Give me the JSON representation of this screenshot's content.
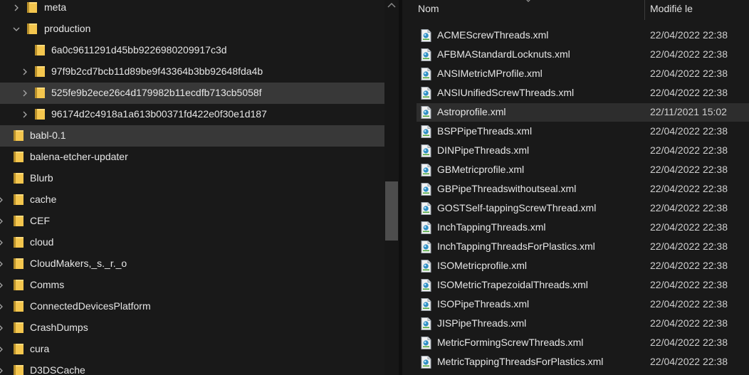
{
  "tree": {
    "items": [
      {
        "label": "meta",
        "expanded": false,
        "selected": false
      },
      {
        "label": "production",
        "expanded": true,
        "selected": false
      },
      {
        "label": "6a0c9611291d45bb9226980209917c3d",
        "expanded": null,
        "selected": false
      },
      {
        "label": "97f9b2cd7bcb11d89be9f43364b3bb92648fda4b",
        "expanded": false,
        "selected": false
      },
      {
        "label": "525fe9b2ece26c4d179982b11ecdfb713cb5058f",
        "expanded": false,
        "selected": true
      },
      {
        "label": "96174d2c4918a1a613b00371fd422e0f30e1d187",
        "expanded": false,
        "selected": false
      },
      {
        "label": "babl-0.1",
        "expanded": null,
        "selected": true
      },
      {
        "label": "balena-etcher-updater",
        "expanded": null,
        "selected": false
      },
      {
        "label": "Blurb",
        "expanded": false,
        "selected": false
      },
      {
        "label": "cache",
        "expanded": false,
        "selected": false
      },
      {
        "label": "CEF",
        "expanded": false,
        "selected": false
      },
      {
        "label": "cloud",
        "expanded": false,
        "selected": false
      },
      {
        "label": "CloudMakers,_s._r._o",
        "expanded": false,
        "selected": false
      },
      {
        "label": "Comms",
        "expanded": false,
        "selected": false
      },
      {
        "label": "ConnectedDevicesPlatform",
        "expanded": false,
        "selected": false
      },
      {
        "label": "CrashDumps",
        "expanded": false,
        "selected": false
      },
      {
        "label": "cura",
        "expanded": false,
        "selected": false
      },
      {
        "label": "D3DSCache",
        "expanded": false,
        "selected": false
      }
    ]
  },
  "list": {
    "col_name": "Nom",
    "col_modified": "Modifié le",
    "files": [
      {
        "name": "ACMEScrewThreads.xml",
        "modified": "22/04/2022 22:38",
        "selected": false
      },
      {
        "name": "AFBMAStandardLocknuts.xml",
        "modified": "22/04/2022 22:38",
        "selected": false
      },
      {
        "name": "ANSIMetricMProfile.xml",
        "modified": "22/04/2022 22:38",
        "selected": false
      },
      {
        "name": "ANSIUnifiedScrewThreads.xml",
        "modified": "22/04/2022 22:38",
        "selected": false
      },
      {
        "name": "Astroprofile.xml",
        "modified": "22/11/2021 15:02",
        "selected": true
      },
      {
        "name": "BSPPipeThreads.xml",
        "modified": "22/04/2022 22:38",
        "selected": false
      },
      {
        "name": "DINPipeThreads.xml",
        "modified": "22/04/2022 22:38",
        "selected": false
      },
      {
        "name": "GBMetricprofile.xml",
        "modified": "22/04/2022 22:38",
        "selected": false
      },
      {
        "name": "GBPipeThreadswithoutseal.xml",
        "modified": "22/04/2022 22:38",
        "selected": false
      },
      {
        "name": "GOSTSelf-tappingScrewThread.xml",
        "modified": "22/04/2022 22:38",
        "selected": false
      },
      {
        "name": "InchTappingThreads.xml",
        "modified": "22/04/2022 22:38",
        "selected": false
      },
      {
        "name": "InchTappingThreadsForPlastics.xml",
        "modified": "22/04/2022 22:38",
        "selected": false
      },
      {
        "name": "ISOMetricprofile.xml",
        "modified": "22/04/2022 22:38",
        "selected": false
      },
      {
        "name": "ISOMetricTrapezoidalThreads.xml",
        "modified": "22/04/2022 22:38",
        "selected": false
      },
      {
        "name": "ISOPipeThreads.xml",
        "modified": "22/04/2022 22:38",
        "selected": false
      },
      {
        "name": "JISPipeThreads.xml",
        "modified": "22/04/2022 22:38",
        "selected": false
      },
      {
        "name": "MetricFormingScrewThreads.xml",
        "modified": "22/04/2022 22:38",
        "selected": false
      },
      {
        "name": "MetricTappingThreadsForPlastics.xml",
        "modified": "22/04/2022 22:38",
        "selected": false
      }
    ]
  },
  "colors": {
    "background": "#191919",
    "selected_row": "#383838",
    "folder_yellow": "#f4c64e",
    "text": "#e6e6e6"
  },
  "icons": {
    "tree_chevron_collapsed": "chevron-right-icon",
    "tree_chevron_expanded": "chevron-down-icon",
    "tree_item": "folder-icon",
    "file_item": "xml-file-icon"
  }
}
